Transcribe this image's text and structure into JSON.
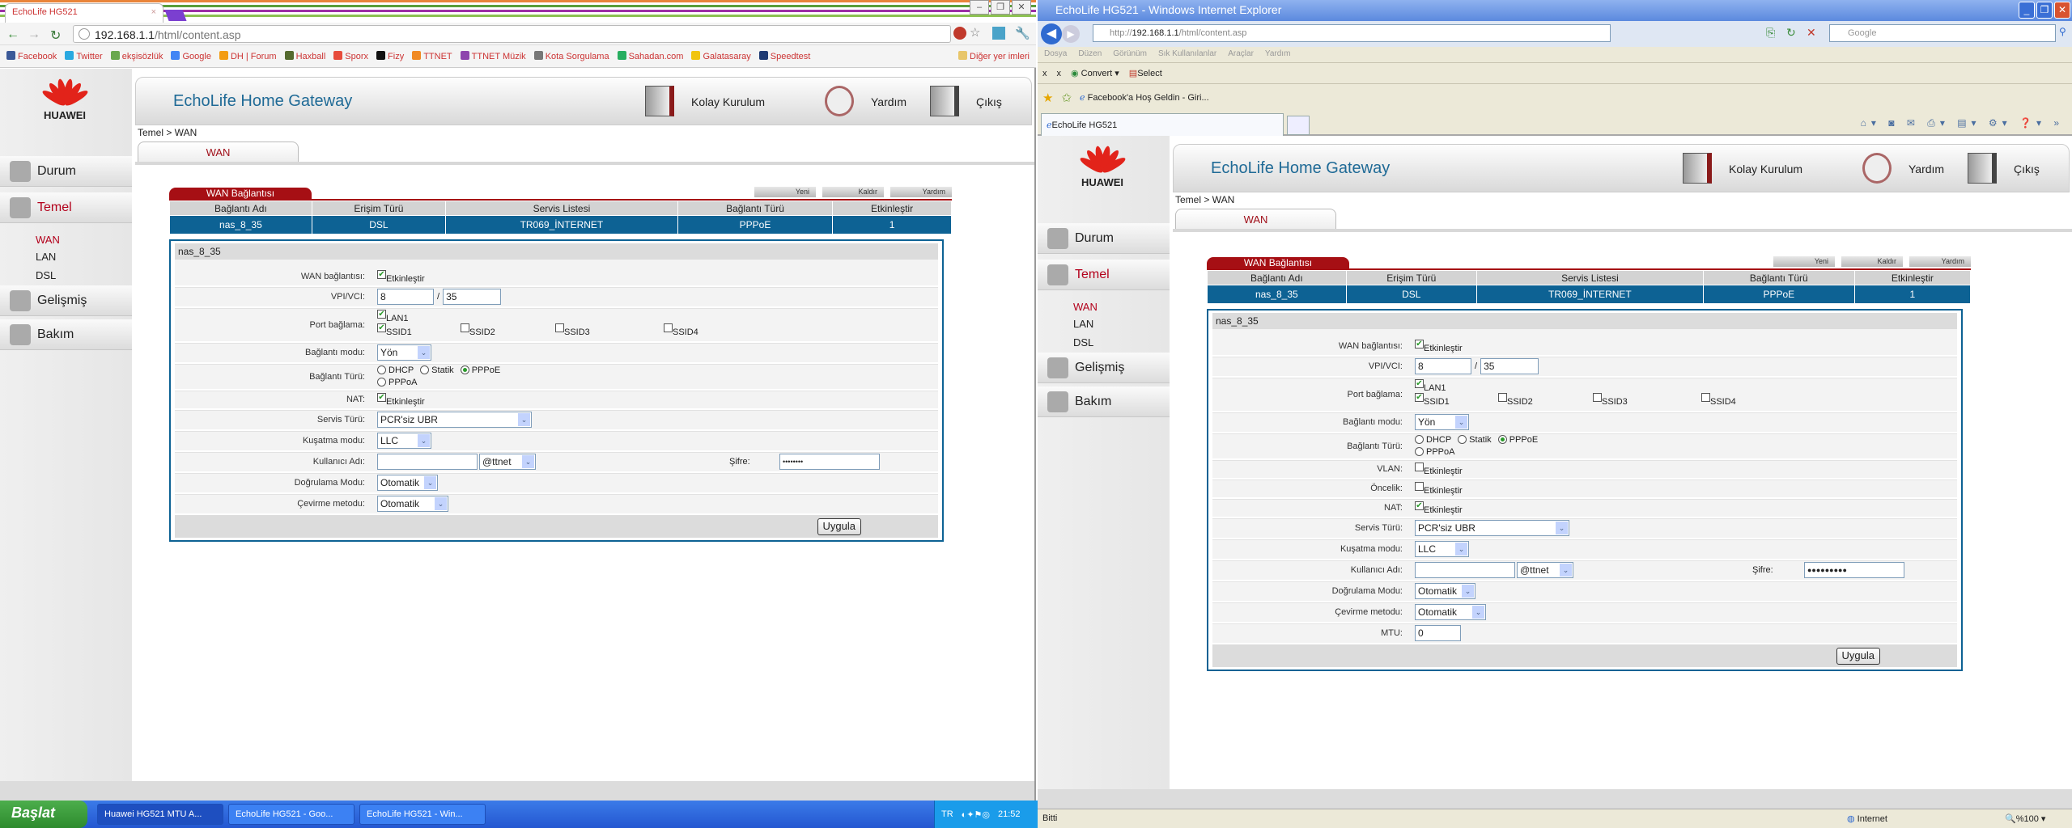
{
  "chrome": {
    "tab_title": "EchoLife HG521",
    "url_host": "192.168.1.1",
    "url_path": "/html/content.asp",
    "bookmarks": [
      {
        "label": "Facebook",
        "color": "#3b5998"
      },
      {
        "label": "Twitter",
        "color": "#2aa9e0"
      },
      {
        "label": "ekşisözlük",
        "color": "#6aa84f"
      },
      {
        "label": "Google",
        "color": "#4285f4"
      },
      {
        "label": "DH | Forum",
        "color": "#f39c12"
      },
      {
        "label": "Haxball",
        "color": "#556b2f"
      },
      {
        "label": "Sporx",
        "color": "#e74c3c"
      },
      {
        "label": "Fizy",
        "color": "#111111"
      },
      {
        "label": "TTNET",
        "color": "#f08a24"
      },
      {
        "label": "TTNET Müzik",
        "color": "#8e44ad"
      },
      {
        "label": "Kota Sorgulama",
        "color": "#777777"
      },
      {
        "label": "Sahadan.com",
        "color": "#27ae60"
      },
      {
        "label": "Galatasaray",
        "color": "#f1c40f"
      },
      {
        "label": "Speedtest",
        "color": "#1f3b73"
      }
    ],
    "other_bookmarks": "Diğer yer imleri"
  },
  "ie": {
    "title": "EchoLife HG521 - Windows Internet Explorer",
    "url_prefix": "http://",
    "url_host": "192.168.1.1",
    "url_path": "/html/content.asp",
    "search_placeholder": "Google",
    "menu": [
      "Dosya",
      "Düzen",
      "Görünüm",
      "Sık Kullanılanlar",
      "Araçlar",
      "Yardım"
    ],
    "toolbar": {
      "convert": "Convert",
      "select": "Select"
    },
    "favorite_item": "Facebook'a Hoş Geldin - Giri...",
    "tab_title": "EchoLife HG521",
    "status": "Bitti",
    "zone": "Internet",
    "zoom": "%100"
  },
  "taskbar": {
    "start": "Başlat",
    "tasks": [
      "Huawei HG521 MTU A...",
      "EchoLife HG521 - Goo...",
      "EchoLife HG521 - Win..."
    ],
    "lang": "TR",
    "time": "21:52"
  },
  "router": {
    "brand": "HUAWEI",
    "title": "EchoLife Home Gateway",
    "nav": [
      {
        "label": "Kolay Kurulum",
        "icon": "easy-setup-icon"
      },
      {
        "label": "Yardım",
        "icon": "help-icon"
      },
      {
        "label": "Çıkış",
        "icon": "logout-icon"
      }
    ],
    "breadcrumb": "Temel > WAN",
    "tab": "WAN",
    "sidebar": [
      {
        "label": "Durum",
        "icon": "status-icon"
      },
      {
        "label": "Temel",
        "icon": "basic-icon",
        "active": true,
        "sub": [
          "WAN",
          "LAN",
          "DSL"
        ]
      },
      {
        "label": "Gelişmiş",
        "icon": "advanced-icon"
      },
      {
        "label": "Bakım",
        "icon": "maintenance-icon"
      }
    ],
    "wan": {
      "title": "WAN Bağlantısı",
      "buttons": [
        "Yeni",
        "Kaldır",
        "Yardım"
      ],
      "columns": [
        "Bağlantı Adı",
        "Erişim Türü",
        "Servis Listesi",
        "Bağlantı Türü",
        "Etkinleştir"
      ],
      "rows": [
        [
          "nas_8_35",
          "DSL",
          "TR069_İNTERNET",
          "PPPoE",
          "1"
        ]
      ]
    },
    "section": "nas_8_35",
    "apply": "Uygula",
    "accent": "#a60f14",
    "table_blue": "#0d6294"
  },
  "forms": {
    "chrome": [
      {
        "label": "WAN bağlantısı:",
        "type": "check",
        "items": [
          {
            "text": "Etkinleştir",
            "checked": true
          }
        ]
      },
      {
        "label": "VPI/VCI:",
        "type": "vpi",
        "vpi": "8",
        "sep": "/",
        "vci": "35"
      },
      {
        "label": "Port bağlama:",
        "type": "ports",
        "items": [
          {
            "text": "LAN1",
            "checked": true
          }
        ],
        "items2": [
          {
            "text": "SSID1",
            "checked": true
          },
          {
            "text": "SSID2",
            "checked": false
          },
          {
            "text": "SSID3",
            "checked": false
          },
          {
            "text": "SSID4",
            "checked": false
          }
        ]
      },
      {
        "label": "Bağlantı modu:",
        "type": "select",
        "value": "Yön"
      },
      {
        "label": "Bağlantı Türü:",
        "type": "radio",
        "options": [
          "DHCP",
          "Statik",
          "PPPoE",
          "PPPoA"
        ],
        "selected": "PPPoE"
      },
      {
        "label": "NAT:",
        "type": "check",
        "items": [
          {
            "text": "Etkinleştir",
            "checked": true
          }
        ]
      },
      {
        "label": "Servis Türü:",
        "type": "select",
        "value": "PCR'siz UBR"
      },
      {
        "label": "Kuşatma modu:",
        "type": "select",
        "value": "LLC"
      },
      {
        "label": "Kullanıcı Adı:",
        "type": "user",
        "username": "",
        "domain": "@ttnet",
        "password_label": "Şifre:",
        "password": "••••••••"
      },
      {
        "label": "Doğrulama Modu:",
        "type": "select",
        "value": "Otomatik"
      },
      {
        "label": "Çevirme metodu:",
        "type": "select",
        "value": "Otomatik"
      }
    ],
    "ie": [
      {
        "label": "WAN bağlantısı:",
        "type": "check",
        "items": [
          {
            "text": "Etkinleştir",
            "checked": true
          }
        ]
      },
      {
        "label": "VPI/VCI:",
        "type": "vpi",
        "vpi": "8",
        "sep": "/",
        "vci": "35"
      },
      {
        "label": "Port bağlama:",
        "type": "ports",
        "items": [
          {
            "text": "LAN1",
            "checked": true
          }
        ],
        "items2": [
          {
            "text": "SSID1",
            "checked": true
          },
          {
            "text": "SSID2",
            "checked": false
          },
          {
            "text": "SSID3",
            "checked": false
          },
          {
            "text": "SSID4",
            "checked": false
          }
        ]
      },
      {
        "label": "Bağlantı modu:",
        "type": "select",
        "value": "Yön"
      },
      {
        "label": "Bağlantı Türü:",
        "type": "radio",
        "options": [
          "DHCP",
          "Statik",
          "PPPoE",
          "PPPoA"
        ],
        "selected": "PPPoE"
      },
      {
        "label": "VLAN:",
        "type": "check",
        "items": [
          {
            "text": "Etkinleştir",
            "checked": false
          }
        ]
      },
      {
        "label": "Öncelik:",
        "type": "check",
        "items": [
          {
            "text": "Etkinleştir",
            "checked": false
          }
        ]
      },
      {
        "label": "NAT:",
        "type": "check",
        "items": [
          {
            "text": "Etkinleştir",
            "checked": true
          }
        ]
      },
      {
        "label": "Servis Türü:",
        "type": "select",
        "value": "PCR'siz UBR"
      },
      {
        "label": "Kuşatma modu:",
        "type": "select",
        "value": "LLC"
      },
      {
        "label": "Kullanıcı Adı:",
        "type": "user",
        "username": "",
        "domain": "@ttnet",
        "password_label": "Şifre:",
        "password": "●●●●●●●●●"
      },
      {
        "label": "Doğrulama Modu:",
        "type": "select",
        "value": "Otomatik"
      },
      {
        "label": "Çevirme metodu:",
        "type": "select",
        "value": "Otomatik"
      },
      {
        "label": "MTU:",
        "type": "text",
        "value": "0"
      }
    ]
  }
}
